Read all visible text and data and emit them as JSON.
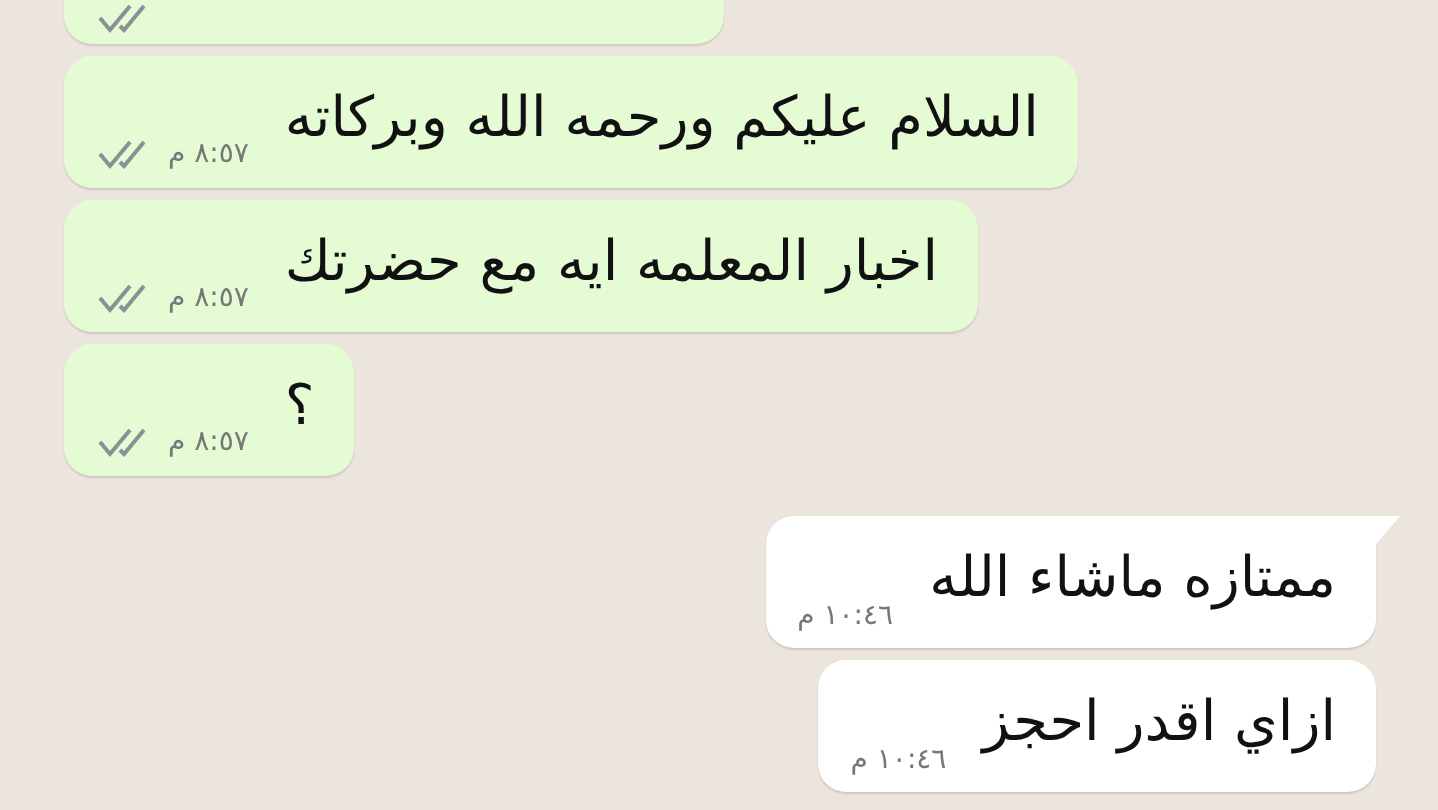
{
  "messages": [
    {
      "kind": "sent",
      "text": "السلام عليكم ورحمه الله وبركاته",
      "time": "٨:٥٧ م",
      "read": false
    },
    {
      "kind": "sent",
      "text": "اخبار المعلمه ايه مع حضرتك",
      "time": "٨:٥٧ م",
      "read": false
    },
    {
      "kind": "sent",
      "text": "؟",
      "time": "٨:٥٧ م",
      "read": false
    },
    {
      "kind": "received",
      "text": "ممتازه ماشاء الله",
      "time": "١٠:٤٦ م",
      "tail": true
    },
    {
      "kind": "received",
      "text": "ازاي اقدر احجز",
      "time": "١٠:٤٦ م",
      "tail": false
    }
  ]
}
